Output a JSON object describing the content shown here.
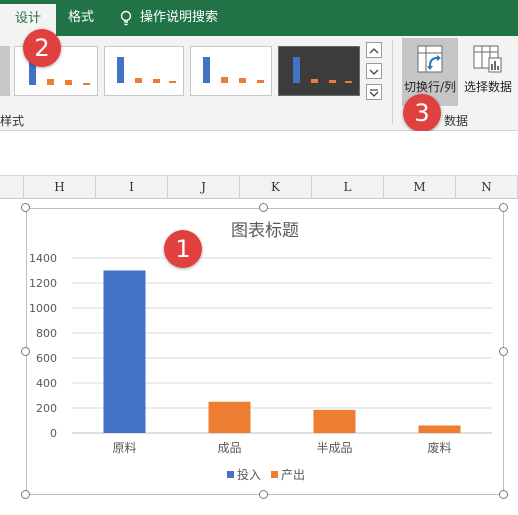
{
  "ribbon": {
    "tabs": [
      {
        "label": "设计",
        "active": true
      },
      {
        "label": "格式",
        "active": false
      },
      {
        "label": "操作说明搜索",
        "active": false
      }
    ],
    "style_group_label": "样式",
    "switch_button_label": "切换行/列",
    "select_data_label": "选择数据",
    "data_group_label": "数据"
  },
  "badges": {
    "b1": "1",
    "b2": "2",
    "b3": "3"
  },
  "columns": [
    "H",
    "I",
    "J",
    "K",
    "L",
    "M",
    "N"
  ],
  "colors": {
    "ribbon": "#217346",
    "series_input": "#4472c4",
    "series_output": "#ed7d31",
    "badge": "#e04040"
  },
  "chart_data": {
    "type": "bar",
    "title": "图表标题",
    "categories": [
      "原料",
      "成品",
      "半成品",
      "废料"
    ],
    "series": [
      {
        "name": "投入",
        "values": [
          1300,
          null,
          null,
          null
        ],
        "color": "#4472c4"
      },
      {
        "name": "产出",
        "values": [
          null,
          250,
          185,
          60
        ],
        "color": "#ed7d31"
      }
    ],
    "ylim": [
      0,
      1400
    ],
    "yticks": [
      0,
      200,
      400,
      600,
      800,
      1000,
      1200,
      1400
    ],
    "grid": true,
    "legend": "bottom"
  }
}
